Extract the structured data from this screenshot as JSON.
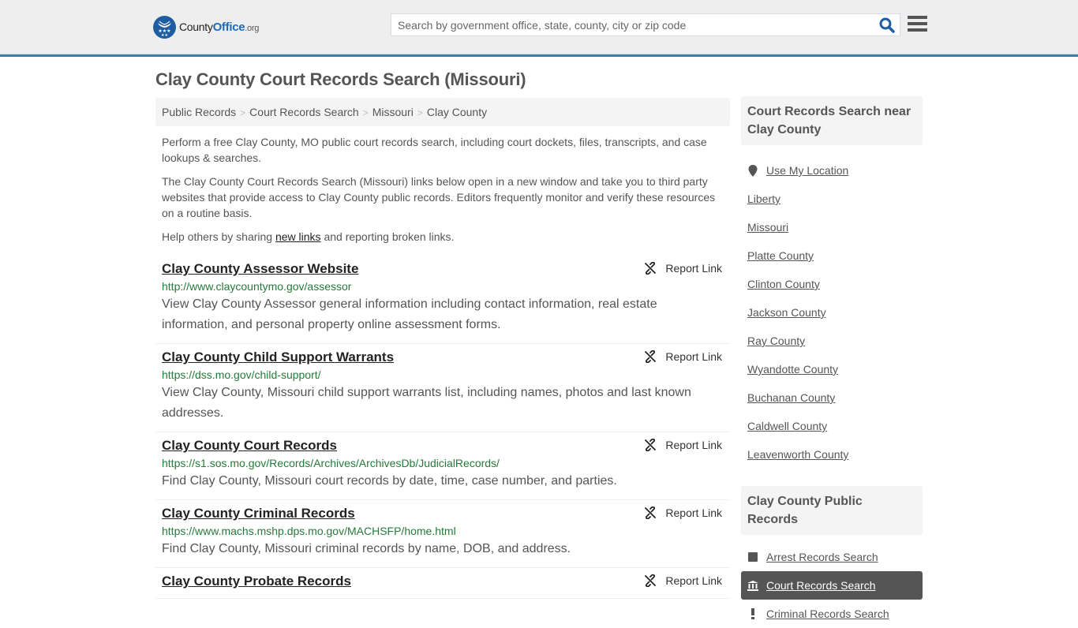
{
  "header": {
    "logo": {
      "county": "County",
      "office": "Office",
      "org": ".org"
    },
    "search_placeholder": "Search by government office, state, county, city or zip code"
  },
  "colors": {
    "accent": "#3a7bab",
    "brand_blue": "#1e5da0",
    "url_green": "#267a3a",
    "active_bg": "#555555"
  },
  "page_title": "Clay County Court Records Search (Missouri)",
  "breadcrumb": [
    "Public Records",
    "Court Records Search",
    "Missouri",
    "Clay County"
  ],
  "intro": {
    "p1": "Perform a free Clay County, MO public court records search, including court dockets, files, transcripts, and case lookups & searches.",
    "p2": "The Clay County Court Records Search (Missouri) links below open in a new window and take you to third party websites that provide access to Clay County public records. Editors frequently monitor and verify these resources on a routine basis.",
    "p3_before": "Help others by sharing ",
    "p3_link": "new links",
    "p3_after": " and reporting broken links."
  },
  "report_label": "Report Link",
  "results": [
    {
      "title": "Clay County Assessor Website",
      "url": "http://www.claycountymo.gov/assessor",
      "desc": "View Clay County Assessor general information including contact information, real estate information, and personal property online assessment forms."
    },
    {
      "title": "Clay County Child Support Warrants",
      "url": "https://dss.mo.gov/child-support/",
      "desc": "View Clay County, Missouri child support warrants list, including names, photos and last known addresses."
    },
    {
      "title": "Clay County Court Records",
      "url": "https://s1.sos.mo.gov/Records/Archives/ArchivesDb/JudicialRecords/",
      "desc": "Find Clay County, Missouri court records by date, time, case number, and parties."
    },
    {
      "title": "Clay County Criminal Records",
      "url": "https://www.machs.mshp.dps.mo.gov/MACHSFP/home.html",
      "desc": "Find Clay County, Missouri criminal records by name, DOB, and address."
    },
    {
      "title": "Clay County Probate Records",
      "url": "",
      "desc": ""
    }
  ],
  "sidebar": {
    "near_title": "Court Records Search near Clay County",
    "use_location": "Use My Location",
    "near_items": [
      "Liberty",
      "Missouri",
      "Platte County",
      "Clinton County",
      "Jackson County",
      "Ray County",
      "Wyandotte County",
      "Buchanan County",
      "Caldwell County",
      "Leavenworth County"
    ],
    "public_title": "Clay County Public Records",
    "public_items": [
      {
        "label": "Arrest Records Search",
        "icon": "square-icon"
      },
      {
        "label": "Court Records Search",
        "icon": "courthouse-icon",
        "active": true
      },
      {
        "label": "Criminal Records Search",
        "icon": "exclamation-icon"
      }
    ]
  }
}
